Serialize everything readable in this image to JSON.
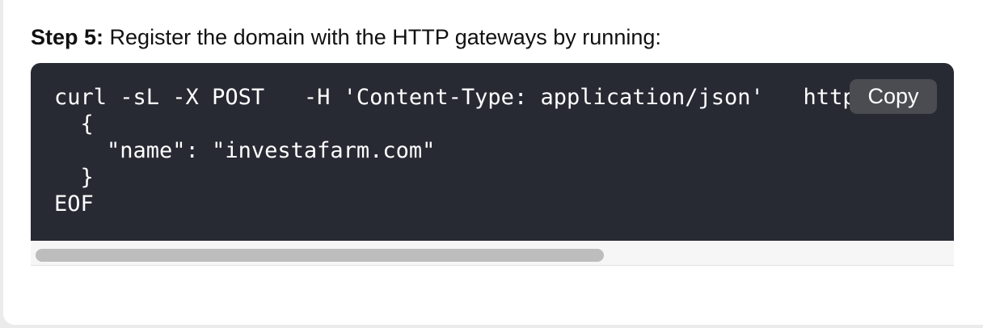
{
  "step": {
    "label": "Step 5:",
    "text": " Register the domain with the HTTP gateways by running:"
  },
  "code": {
    "text": "curl -sL -X POST   -H 'Content-Type: application/json'   https://\n  {\n    \"name\": \"investafarm.com\"\n  }\nEOF",
    "copy_label": "Copy"
  },
  "scrollbar": {
    "thumb_fraction": 0.62
  }
}
